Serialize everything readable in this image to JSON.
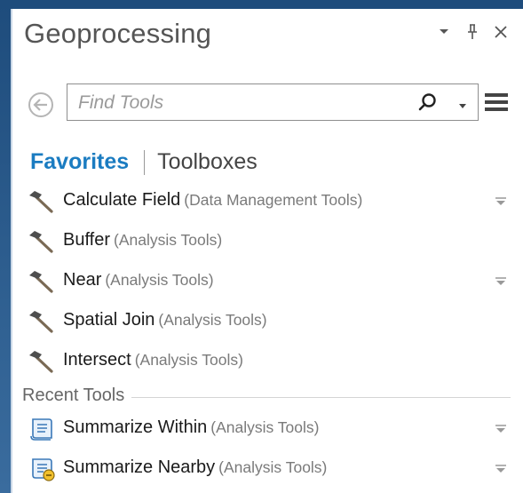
{
  "panel": {
    "title": "Geoprocessing"
  },
  "search": {
    "placeholder": "Find Tools",
    "value": ""
  },
  "tabs": {
    "favorites": "Favorites",
    "toolboxes": "Toolboxes"
  },
  "favorites": [
    {
      "name": "Calculate Field",
      "source": "(Data Management Tools)",
      "has_options": true
    },
    {
      "name": "Buffer",
      "source": "(Analysis Tools)",
      "has_options": false
    },
    {
      "name": "Near",
      "source": "(Analysis Tools)",
      "has_options": true
    },
    {
      "name": "Spatial Join",
      "source": "(Analysis Tools)",
      "has_options": false
    },
    {
      "name": "Intersect",
      "source": "(Analysis Tools)",
      "has_options": false
    }
  ],
  "recent": {
    "label": "Recent Tools",
    "items": [
      {
        "name": "Summarize Within",
        "source": "(Analysis Tools)",
        "icon": "script-tool-icon",
        "has_options": true
      },
      {
        "name": "Summarize Nearby",
        "source": "(Analysis Tools)",
        "icon": "script-tool-badge-icon",
        "has_options": true
      }
    ]
  },
  "colors": {
    "accent": "#1b7cc1",
    "frame": "#2b5a8a"
  }
}
